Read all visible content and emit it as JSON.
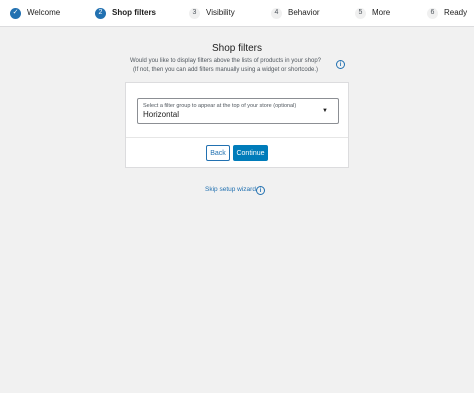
{
  "stepper": {
    "steps": [
      {
        "num": "✓",
        "label": "Welcome"
      },
      {
        "num": "2",
        "label": "Shop filters"
      },
      {
        "num": "3",
        "label": "Visibility"
      },
      {
        "num": "4",
        "label": "Behavior"
      },
      {
        "num": "5",
        "label": "More"
      },
      {
        "num": "6",
        "label": "Ready"
      }
    ]
  },
  "main": {
    "title": "Shop filters",
    "description": "Would you like to display filters above the lists of products in your shop? (If not, then you can add filters manually using a widget or shortcode.)",
    "info_icon": "i"
  },
  "select": {
    "label": "Select a filter group to appear at the top of your store (optional)",
    "value": "Horizontal",
    "caret": "▼"
  },
  "actions": {
    "back_label": "Back",
    "continue_label": "Continue"
  },
  "skip": {
    "label": "Skip setup wizard",
    "info_icon": "i"
  },
  "colors": {
    "accent": "#2271b1",
    "primary_button": "#007cba",
    "background": "#f1f1f1"
  }
}
